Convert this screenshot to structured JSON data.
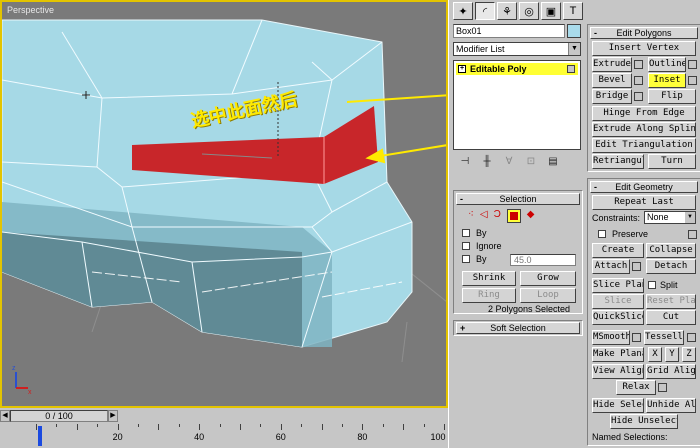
{
  "viewport": {
    "label": "Perspective",
    "annotation": "选中此面然后"
  },
  "timeline": {
    "frame_display": "0 / 100",
    "ticks": [
      {
        "v": 20,
        "label": "20"
      },
      {
        "v": 40,
        "label": "40"
      },
      {
        "v": 60,
        "label": "60"
      },
      {
        "v": 80,
        "label": "80"
      },
      {
        "v": 100,
        "label": "100"
      }
    ]
  },
  "toolbar": {
    "icons": [
      "cursor-icon",
      "arc-icon",
      "modify-icon",
      "motion-icon",
      "display-icon",
      "utilities-icon"
    ]
  },
  "modifier": {
    "object_name": "Box01",
    "object_color": "#a9dbeb",
    "modifier_list": "Modifier List",
    "stack_item": "Editable Poly"
  },
  "selection": {
    "title": "Selection",
    "by_vertex": "By",
    "ignore": "Ignore",
    "by_angle": "By",
    "angle_value": "45.0",
    "shrink": "Shrink",
    "grow": "Grow",
    "ring": "Ring",
    "loop": "Loop",
    "status": "2 Polygons Selected"
  },
  "soft_selection": {
    "title": "Soft Selection"
  },
  "edit_polygons": {
    "title": "Edit Polygons",
    "insert_vertex": "Insert Vertex",
    "extrude": "Extrude",
    "outline": "Outline",
    "bevel": "Bevel",
    "inset": "Inset",
    "bridge": "Bridge",
    "flip": "Flip",
    "hinge": "Hinge From Edge",
    "extrude_spline": "Extrude Along Spline",
    "edit_tri": "Edit Triangulation",
    "retri": "Retriangulate",
    "turn": "Turn"
  },
  "edit_geometry": {
    "title": "Edit Geometry",
    "repeat_last": "Repeat Last",
    "constraints_label": "Constraints:",
    "constraints_value": "None",
    "preserve": "Preserve",
    "create": "Create",
    "collapse": "Collapse",
    "attach": "Attach",
    "detach": "Detach",
    "slice_plane": "Slice Plane",
    "split": "Split",
    "slice": "Slice",
    "reset_plane": "Reset Plane",
    "quickslice": "QuickSlice",
    "cut": "Cut",
    "msmooth": "MSmooth",
    "tessellate": "Tessellate",
    "make_planar": "Make Planar",
    "x": "X",
    "y": "Y",
    "z": "Z",
    "view_align": "View Align",
    "grid_align": "Grid Align",
    "relax": "Relax",
    "hide_selected": "Hide Selected",
    "unhide_all": "Unhide All",
    "hide_unselected": "Hide Unselected",
    "named_selections": "Named Selections:"
  },
  "colors": {
    "accent_yellow": "#ffff3a",
    "selected_face": "#c8262a",
    "mesh": "#a6d9e6",
    "viewport_bg": "#7a7a7a"
  }
}
